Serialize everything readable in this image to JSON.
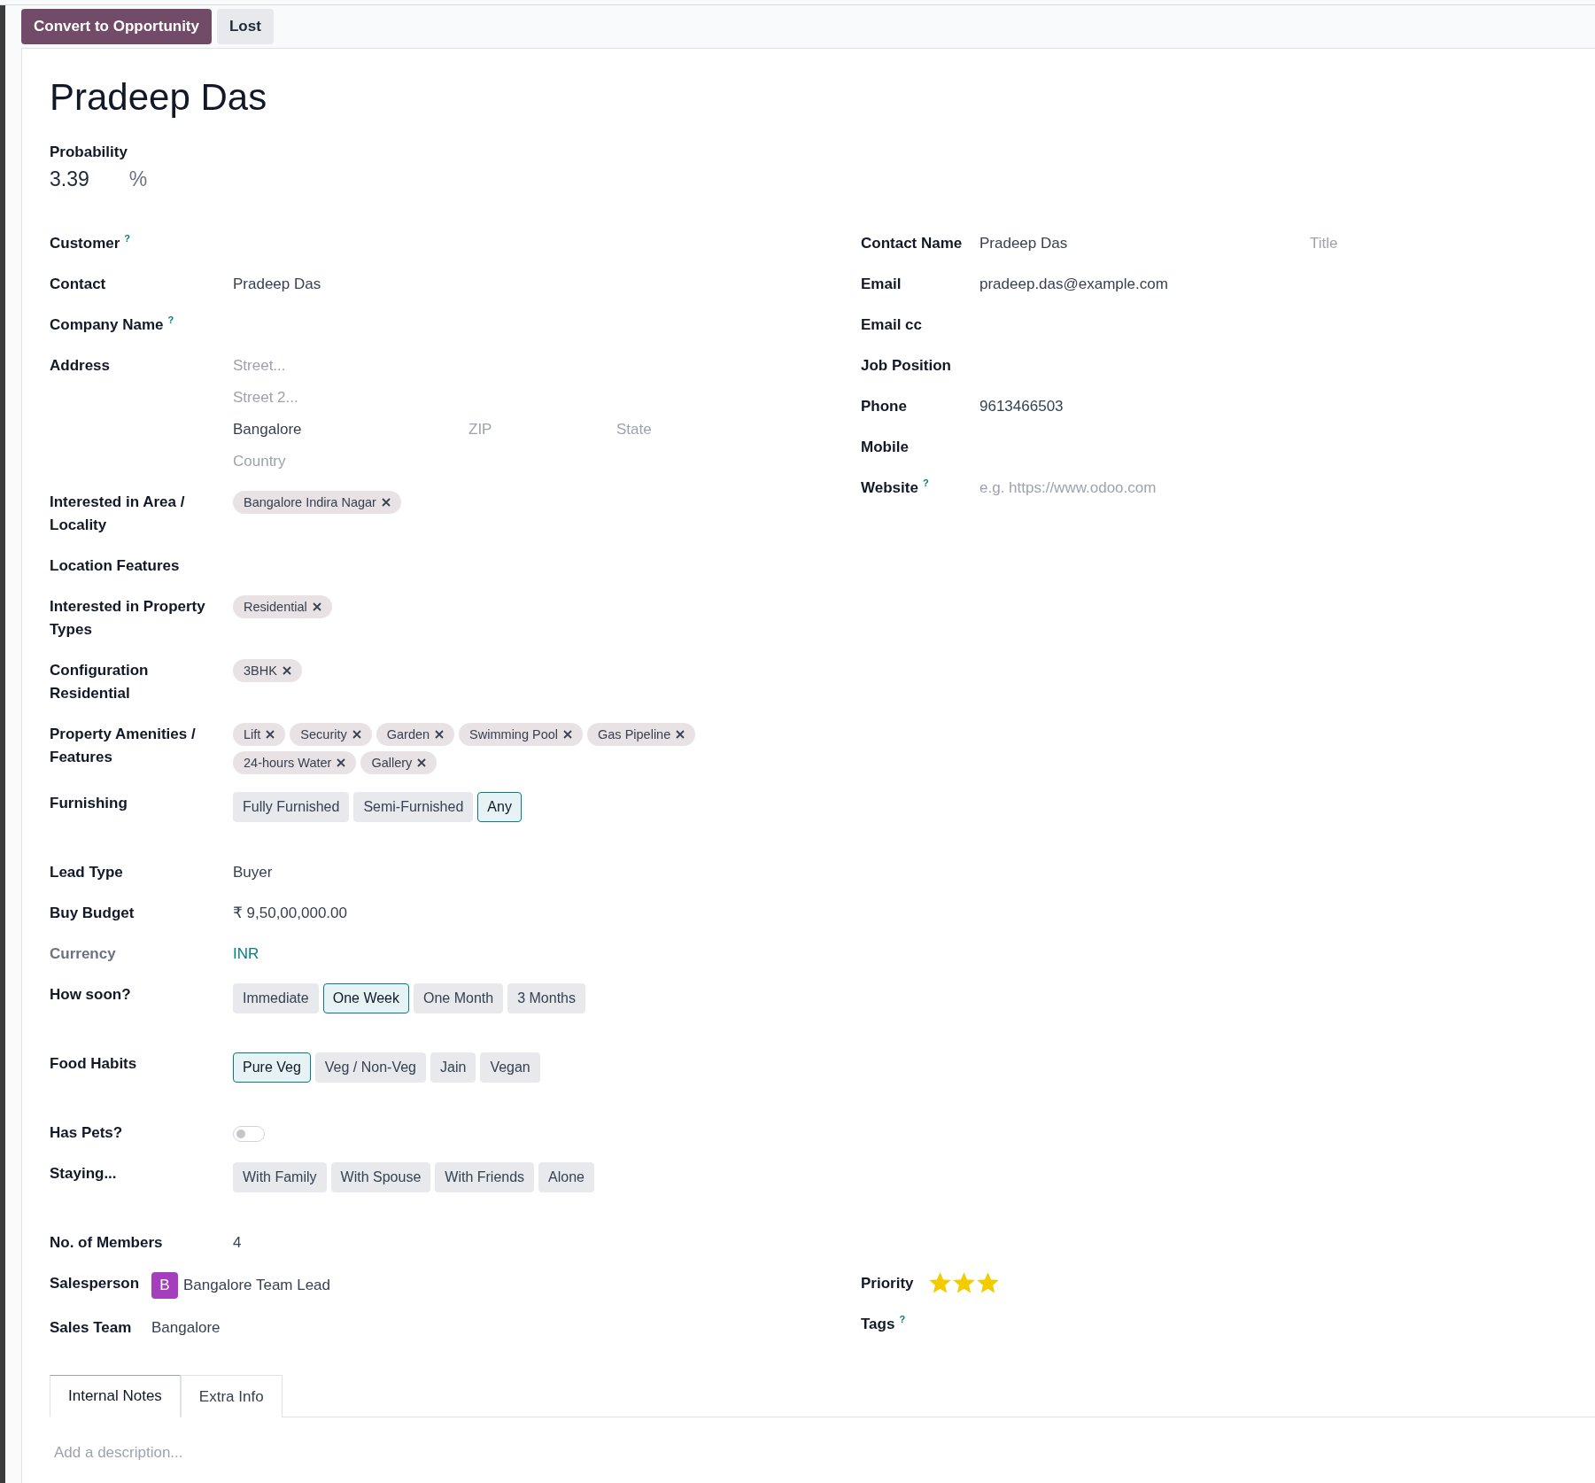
{
  "actions": [
    {
      "label": "Convert to Opportunity",
      "kind": "primary"
    },
    {
      "label": "Lost",
      "kind": "secondary"
    }
  ],
  "title": "Pradeep Das",
  "probability": {
    "label": "Probability",
    "value": "3.39",
    "unit": "%"
  },
  "left_fields": [
    {
      "label": "Customer",
      "hint_mark": "?",
      "kind": "empty"
    },
    {
      "label": "Contact",
      "kind": "text",
      "value": "Pradeep Das"
    },
    {
      "label": "Company Name",
      "hint_mark": "?",
      "kind": "empty"
    },
    {
      "label": "Address",
      "kind": "address",
      "street": {
        "placeholder": "Street..."
      },
      "street2": {
        "placeholder": "Street 2..."
      },
      "city": {
        "value": "Bangalore"
      },
      "zip": {
        "placeholder": "ZIP"
      },
      "state": {
        "placeholder": "State"
      },
      "country": {
        "placeholder": "Country"
      }
    },
    {
      "label": "Interested in Area / Locality",
      "kind": "tags",
      "tags": [
        "Bangalore Indira Nagar"
      ]
    },
    {
      "label": "Location Features",
      "kind": "empty"
    },
    {
      "label": "Interested in Property Types",
      "kind": "tags",
      "tags": [
        "Residential"
      ]
    },
    {
      "label": "Configuration Residential",
      "kind": "tags",
      "tags": [
        "3BHK"
      ]
    },
    {
      "label": "Property Amenities / Features",
      "kind": "tags",
      "tags": [
        "Lift",
        "Security",
        "Garden",
        "Swimming Pool",
        "Gas Pipeline",
        "24-hours Water",
        "Gallery"
      ]
    },
    {
      "label": "Furnishing",
      "kind": "selection",
      "options": [
        {
          "label": "Fully Furnished",
          "selected": false
        },
        {
          "label": "Semi-Furnished",
          "selected": false
        },
        {
          "label": "Any",
          "selected": true
        }
      ]
    },
    {
      "label": "Lead Type",
      "kind": "text",
      "value": "Buyer"
    },
    {
      "label": "Buy Budget",
      "kind": "text",
      "value": "₹ 9,50,00,000.00"
    },
    {
      "label": "Currency",
      "kind": "link",
      "value": "INR"
    },
    {
      "label": "How soon?",
      "kind": "selection",
      "options": [
        {
          "label": "Immediate",
          "selected": false
        },
        {
          "label": "One Week",
          "selected": true
        },
        {
          "label": "One Month",
          "selected": false
        },
        {
          "label": "3 Months",
          "selected": false
        }
      ]
    },
    {
      "label": "Food Habits",
      "kind": "selection",
      "options": [
        {
          "label": "Pure Veg",
          "selected": true
        },
        {
          "label": "Veg / Non-Veg",
          "selected": false
        },
        {
          "label": "Jain",
          "selected": false
        },
        {
          "label": "Vegan",
          "selected": false
        }
      ]
    },
    {
      "label": "Has Pets?",
      "kind": "toggle",
      "on": false
    },
    {
      "label": "Staying...",
      "kind": "selection",
      "options": [
        {
          "label": "With Family",
          "selected": false
        },
        {
          "label": "With Spouse",
          "selected": false
        },
        {
          "label": "With Friends",
          "selected": false
        },
        {
          "label": "Alone",
          "selected": false
        }
      ]
    },
    {
      "label": "No. of Members",
      "kind": "text",
      "value": "4"
    }
  ],
  "right_fields": [
    {
      "label": "Contact Name",
      "kind": "name_title",
      "value": "Pradeep Das",
      "title_placeholder": "Title"
    },
    {
      "label": "Email",
      "kind": "text",
      "value": "pradeep.das@example.com"
    },
    {
      "label": "Email cc",
      "kind": "empty"
    },
    {
      "label": "Job Position",
      "kind": "empty"
    },
    {
      "label": "Phone",
      "kind": "text",
      "value": "9613466503"
    },
    {
      "label": "Mobile",
      "kind": "empty"
    },
    {
      "label": "Website",
      "hint_mark": "?",
      "kind": "placeholder",
      "placeholder": "e.g. https://www.odoo.com"
    }
  ],
  "bottom_left": [
    {
      "label": "Salesperson",
      "kind": "avatar",
      "initial": "B",
      "value": "Bangalore Team Lead"
    },
    {
      "label": "Sales Team",
      "kind": "text",
      "value": "Bangalore"
    }
  ],
  "bottom_right": [
    {
      "label": "Priority",
      "kind": "stars",
      "stars": 3
    },
    {
      "label": "Tags",
      "hint_mark": "?",
      "kind": "empty"
    }
  ],
  "tabs": [
    {
      "label": "Internal Notes",
      "selected": true
    },
    {
      "label": "Extra Info",
      "selected": false
    }
  ],
  "notes": {
    "placeholder": "Add a description..."
  }
}
